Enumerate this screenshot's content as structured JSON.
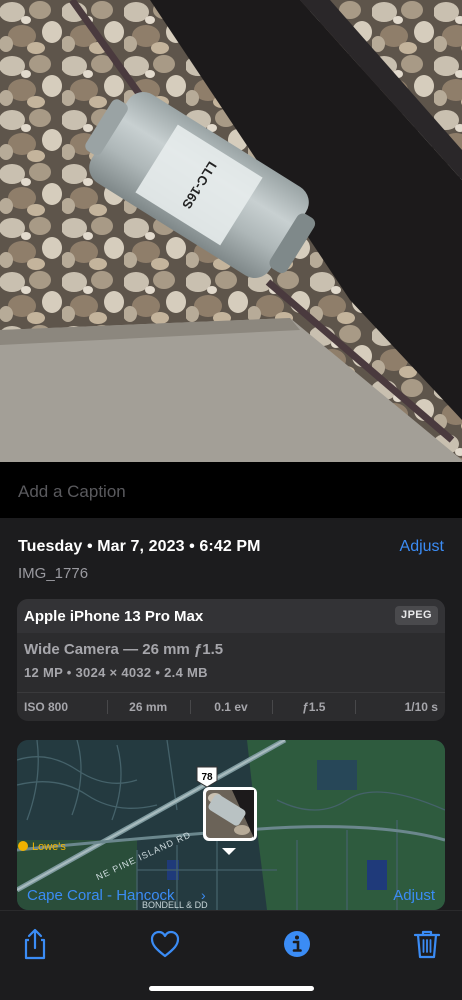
{
  "photo": {
    "label_text": "LLC-16S"
  },
  "caption": {
    "placeholder": "Add a Caption"
  },
  "info": {
    "date": "Tuesday • Mar 7, 2023 • 6:42 PM",
    "adjust_label": "Adjust",
    "filename": "IMG_1776",
    "device": {
      "name": "Apple iPhone 13 Pro Max",
      "format": "JPEG",
      "lens": "Wide Camera — 26 mm ƒ1.5",
      "specs": "12 MP  •  3024 × 4032  •  2.4 MB",
      "exif": {
        "iso": "ISO 800",
        "focal": "26 mm",
        "ev": "0.1 ev",
        "aperture": "ƒ1.5",
        "shutter": "1/10 s"
      }
    },
    "map": {
      "road_label": "NE PINE ISLAND RD",
      "route_number": "78",
      "poi": "Lowe's",
      "partial_road": "BONDELL & DD",
      "location": "Cape Coral - Hancock",
      "adjust_label": "Adjust"
    }
  },
  "toolbar": {
    "share": "share-icon",
    "favorite": "heart-icon",
    "info": "info-icon",
    "delete": "trash-icon"
  },
  "colors": {
    "accent": "#3b8cf5",
    "background": "#1c1c1e",
    "card": "#2c2c2e"
  }
}
